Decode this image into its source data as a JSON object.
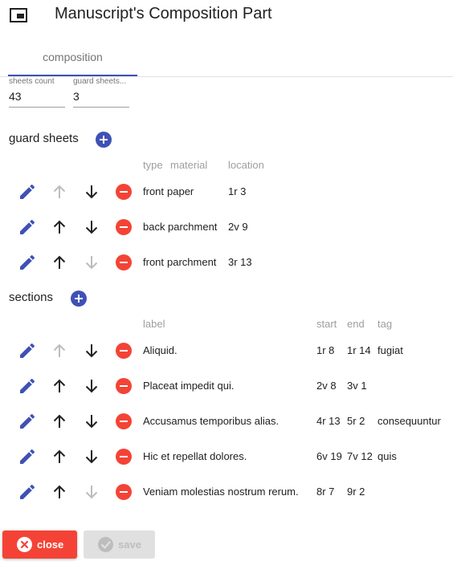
{
  "header": {
    "title": "Manuscript's Composition Part",
    "icon": "window-icon"
  },
  "tabs": [
    {
      "label": "composition",
      "active": true
    }
  ],
  "fields": {
    "sheets_count": {
      "label": "sheets count",
      "value": "43"
    },
    "guard_sheets": {
      "label": "guard sheets...",
      "value": "3"
    }
  },
  "guard_sheets": {
    "title": "guard sheets",
    "columns": {
      "type": "type",
      "material": "material",
      "location": "location"
    },
    "rows": [
      {
        "type": "front",
        "material": "paper",
        "location": "1r 3",
        "up_enabled": false,
        "down_enabled": true
      },
      {
        "type": "back",
        "material": "parchment",
        "location": "2v 9",
        "up_enabled": true,
        "down_enabled": true
      },
      {
        "type": "front",
        "material": "parchment",
        "location": "3r 13",
        "up_enabled": true,
        "down_enabled": false
      }
    ]
  },
  "sections": {
    "title": "sections",
    "columns": {
      "label": "label",
      "start": "start",
      "end": "end",
      "tag": "tag"
    },
    "rows": [
      {
        "label": "Aliquid.",
        "start": "1r 8",
        "end": "1r 14",
        "tag": "fugiat",
        "up_enabled": false,
        "down_enabled": true
      },
      {
        "label": "Placeat impedit qui.",
        "start": "2v 8",
        "end": "3v 1",
        "tag": "",
        "up_enabled": true,
        "down_enabled": true
      },
      {
        "label": "Accusamus temporibus alias.",
        "start": "4r 13",
        "end": "5r 2",
        "tag": "consequuntur",
        "up_enabled": true,
        "down_enabled": true
      },
      {
        "label": "Hic et repellat dolores.",
        "start": "6v 19",
        "end": "7v 12",
        "tag": "quis",
        "up_enabled": true,
        "down_enabled": true
      },
      {
        "label": "Veniam molestias nostrum rerum.",
        "start": "8r 7",
        "end": "9r 2",
        "tag": "",
        "up_enabled": true,
        "down_enabled": false
      }
    ]
  },
  "actions": {
    "close_label": "close",
    "save_label": "save",
    "save_enabled": false
  },
  "colors": {
    "primary": "#3f51b5",
    "warn": "#f44336",
    "disabled": "#bdbdbd"
  }
}
